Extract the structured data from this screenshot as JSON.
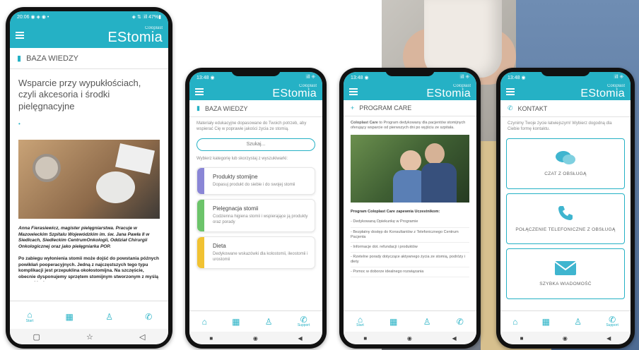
{
  "phone1": {
    "status_time": "20:06 ◉ ◈ ◉ •",
    "status_right": "◈ ⇅ ⫶ill 47%▮",
    "brand_small": "Coloplast",
    "brand_big": "EStomia",
    "section_title": "BAZA WIEDZY",
    "article_title": "Wsparcie przy wypukłościach, czyli akcesoria i środki pielęgnacyjne",
    "author": "Anna Fierasiewicz, magister pielęgniarstwa. Pracuje w Mazowieckim Szpitalu Wojewódzkim im. św. Jana Pawła II w Siedlcach, Siedleckim CentrumOnkologii, Oddział Chirurgii Onkologicznej oraz jako pielęgniarka POP.",
    "body": "Po zabiegu wyłonienia stomii może dojść do powstania późnych powikłań pooperacyjnych. Jedną z najczęstszych tego typu komplikacji jest przepuklina okołostomijna. Na szczęście, obecnie dysponujemy sprzętem stomijnym stworzonym z myślą o wypukłych",
    "nav_start": "Start"
  },
  "phone2": {
    "status_time": "13:48 ◉",
    "status_right": "⫶ill ◈",
    "brand_small": "Coloplast",
    "brand_big": "EStomia",
    "section_title": "BAZA WIEDZY",
    "intro": "Materiały edukacyjne dopasowane do Twoich potrzeb, aby wspierać Cię w poprawie jakości życia ze stomią.",
    "search_placeholder": "Szukaj...",
    "choose": "Wybierz kategorię lub skorzystaj z wyszukiwarki:",
    "cards": [
      {
        "title": "Produkty stomijne",
        "desc": "Dopasuj produkt do siebie i do swojej stomii",
        "color": "#8a86d6"
      },
      {
        "title": "Pielęgnacja stomii",
        "desc": "Codzienna higiena stomii i wspierające ją produkty oraz porady",
        "color": "#6cc46a"
      },
      {
        "title": "Dieta",
        "desc": "Dedykowane wskazówki dla kolostomii, ileostomii i urostomii",
        "color": "#f1c232"
      }
    ],
    "nav_support": "Support"
  },
  "phone3": {
    "status_time": "13:48 ◉",
    "status_right": "⫶ill ◈",
    "brand_small": "Coloplast",
    "brand_big": "EStomia",
    "section_title": "PROGRAM CARE",
    "intro_bold": "Coloplast Care",
    "intro_rest": "to Program dedykowany dla pacjentów stomijnych oferujący wsparcie od pierwszych dni po wyjściu ze szpitala.",
    "provides": "Program Coloplast Care zapewnia Uczestnikom:",
    "items": [
      "- Dedykowaną Opiekunkę w Programie",
      "- Bezpłatny dostęp do Konsultantów z Telefonicznego Centrum Pacjenta",
      "- Informacje dot. refundacji i produktów",
      "- Rzetelne porady dotyczące aktywnego życia ze stomią, podróży i diety",
      "- Pomoc w doborze idealnego rozwiązania"
    ],
    "nav_start": "Start"
  },
  "phone4": {
    "status_time": "13:48 ◉",
    "status_right": "⫶ill ◈",
    "brand_small": "Coloplast",
    "brand_big": "EStomia",
    "section_title": "KONTAKT",
    "intro": "Czynimy Twoje życie łatwiejszym! Wybierz dogodną dla Ciebie formę kontaktu.",
    "chat": "CZAT Z OBSŁUGĄ",
    "phone": "POŁĄCZENIE TELEFONICZNE Z OBSŁUGĄ",
    "message": "SZYBKA WIADOMOŚĆ",
    "nav_support": "Support"
  },
  "icons": {
    "menu": "hamburger-icon",
    "home": "⌂",
    "calendar": "▦",
    "person": "♙",
    "phone": "✆"
  }
}
